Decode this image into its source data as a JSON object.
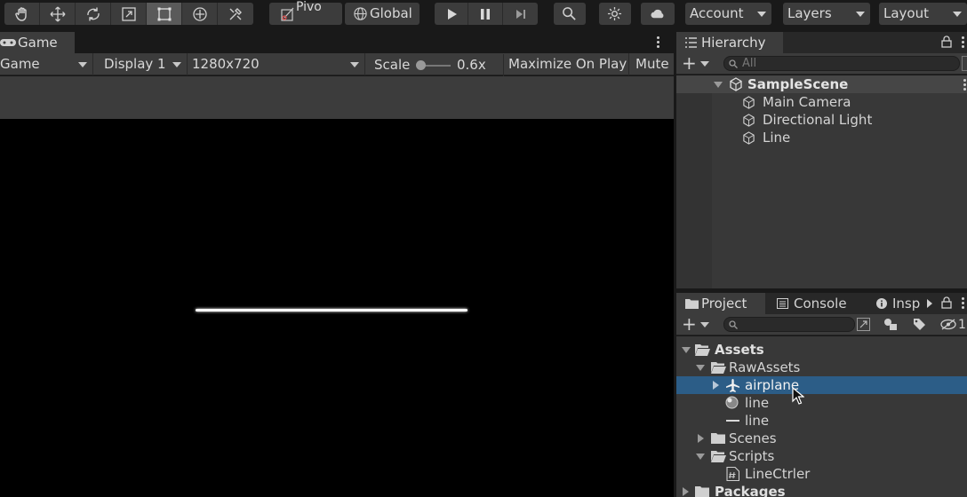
{
  "toolbar": {
    "tools": [
      "hand-tool-icon",
      "move-tool-icon",
      "rotate-tool-icon",
      "scale-tool-icon",
      "rect-tool-icon",
      "transform-tool-icon",
      "custom-tool-icon"
    ],
    "active_tool": "rect-tool-icon",
    "pivot_label": "Pivo",
    "global_label": "Global",
    "account_label": "Account",
    "layers_label": "Layers",
    "layout_label": "Layout"
  },
  "game": {
    "tab_label": "Game",
    "mode_label": "Game",
    "display_label": "Display 1",
    "resolution_label": "1280x720",
    "scale_label": "Scale",
    "scale_value": "0.6x",
    "maximize_label": "Maximize On Play",
    "mute_label": "Mute ,"
  },
  "hierarchy": {
    "tab_label": "Hierarchy",
    "search_placeholder": "All",
    "scene_name": "SampleScene",
    "items": [
      "Main Camera",
      "Directional Light",
      "Line"
    ]
  },
  "project": {
    "tabs": [
      "Project",
      "Console",
      "Insp"
    ],
    "badge_count": "1",
    "tree": {
      "assets": "Assets",
      "raw_assets": "RawAssets",
      "airplane": "airplane",
      "line_material": "line",
      "line_texture": "line",
      "scenes": "Scenes",
      "scripts": "Scripts",
      "line_ctrler": "LineCtrler",
      "packages": "Packages"
    }
  },
  "colors": {
    "panel_bg": "#383838",
    "toolbar_bg": "#3c3c3c",
    "selection": "#2c5d87",
    "game_view": "#000000"
  }
}
